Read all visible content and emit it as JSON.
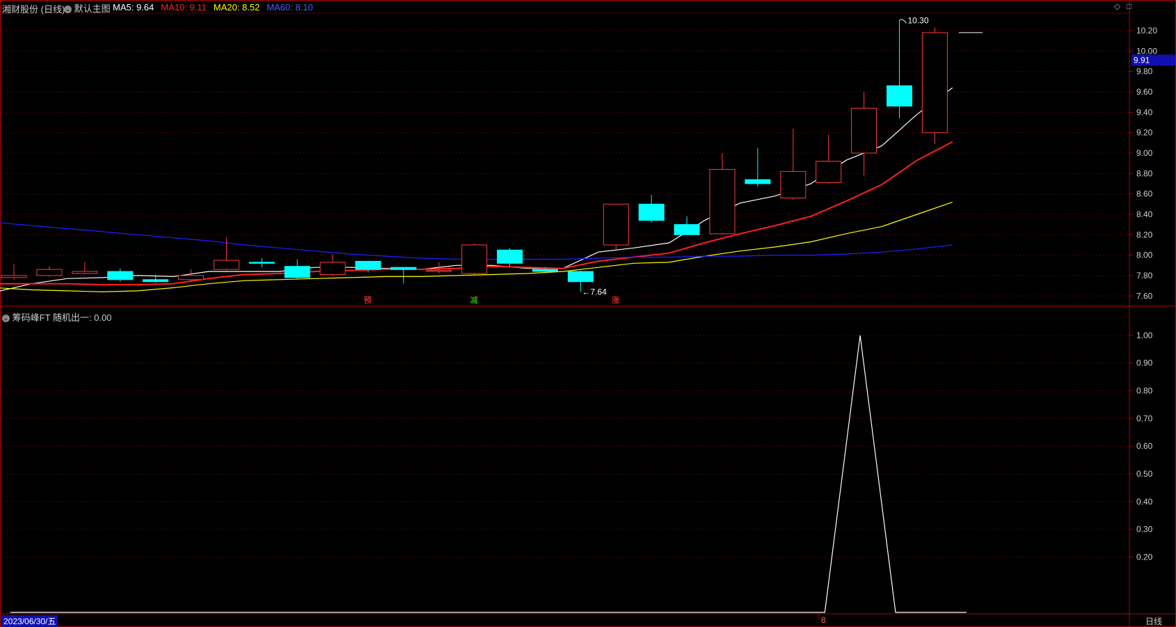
{
  "header": {
    "stock": "湘财股份 (日线)",
    "layout": "默认主图",
    "ma": [
      {
        "label": "MA5: 9.64",
        "color": "#ffffff"
      },
      {
        "label": "MA10: 9.11",
        "color": "#ff2020"
      },
      {
        "label": "MA20: 8.52",
        "color": "#ffff00"
      },
      {
        "label": "MA60: 8.10",
        "color": "#2020ff"
      }
    ]
  },
  "indicator": {
    "title": "筹码峰FT  随机出一: 0.00"
  },
  "footer": {
    "date": "2023/06/30/五",
    "marker": "8",
    "period": "日线"
  },
  "price_tag": "9.91",
  "controls": {
    "diamond": "◇",
    "square": "□"
  },
  "colors": {
    "up": "#ff3b3b",
    "down": "#00ffff",
    "axis": "#b40000",
    "grid": "#5a0000"
  },
  "chart_data": [
    {
      "type": "candlestick",
      "ylim": [
        7.52,
        10.35
      ],
      "yticks": [
        "7.60",
        "7.80",
        "8.00",
        "8.20",
        "8.40",
        "8.60",
        "8.80",
        "9.00",
        "9.20",
        "9.40",
        "9.60",
        "9.80",
        "10.00",
        "10.20"
      ],
      "candles": [
        {
          "o": 7.78,
          "h": 7.91,
          "l": 7.76,
          "c": 7.8
        },
        {
          "o": 7.8,
          "h": 7.89,
          "l": 7.79,
          "c": 7.86
        },
        {
          "o": 7.82,
          "h": 7.93,
          "l": 7.81,
          "c": 7.84
        },
        {
          "o": 7.84,
          "h": 7.87,
          "l": 7.74,
          "c": 7.76
        },
        {
          "o": 7.76,
          "h": 7.81,
          "l": 7.73,
          "c": 7.74
        },
        {
          "o": 7.76,
          "h": 7.86,
          "l": 7.75,
          "c": 7.8
        },
        {
          "o": 7.86,
          "h": 8.17,
          "l": 7.85,
          "c": 7.95
        },
        {
          "o": 7.93,
          "h": 7.97,
          "l": 7.88,
          "c": 7.92
        },
        {
          "o": 7.89,
          "h": 7.96,
          "l": 7.77,
          "c": 7.78
        },
        {
          "o": 7.81,
          "h": 8.01,
          "l": 7.79,
          "c": 7.93
        },
        {
          "o": 7.94,
          "h": 7.94,
          "l": 7.83,
          "c": 7.86
        },
        {
          "o": 7.88,
          "h": 7.88,
          "l": 7.72,
          "c": 7.86
        },
        {
          "o": 7.84,
          "h": 7.93,
          "l": 7.82,
          "c": 7.85
        },
        {
          "o": 7.82,
          "h": 8.11,
          "l": 7.81,
          "c": 8.1
        },
        {
          "o": 8.05,
          "h": 8.07,
          "l": 7.89,
          "c": 7.92
        },
        {
          "o": 7.86,
          "h": 7.88,
          "l": 7.82,
          "c": 7.84
        },
        {
          "o": 7.84,
          "h": 7.85,
          "l": 7.64,
          "c": 7.74
        },
        {
          "o": 8.1,
          "h": 8.5,
          "l": 8.05,
          "c": 8.5
        },
        {
          "o": 8.5,
          "h": 8.59,
          "l": 8.32,
          "c": 8.34
        },
        {
          "o": 8.3,
          "h": 8.38,
          "l": 8.2,
          "c": 8.2
        },
        {
          "o": 8.21,
          "h": 9.0,
          "l": 8.2,
          "c": 8.84
        },
        {
          "o": 8.74,
          "h": 9.05,
          "l": 8.67,
          "c": 8.7
        },
        {
          "o": 8.56,
          "h": 9.24,
          "l": 8.54,
          "c": 8.82
        },
        {
          "o": 8.71,
          "h": 9.18,
          "l": 8.7,
          "c": 8.92
        },
        {
          "o": 9.0,
          "h": 9.6,
          "l": 8.78,
          "c": 9.44
        },
        {
          "o": 9.66,
          "h": 10.3,
          "l": 9.34,
          "c": 9.46
        },
        {
          "o": 9.2,
          "h": 10.23,
          "l": 9.09,
          "c": 10.18
        }
      ],
      "series": [
        {
          "name": "MA5",
          "color": "#ffffff",
          "values": [
            7.64,
            7.72,
            7.77,
            7.78,
            7.8,
            7.79,
            7.84,
            7.84,
            7.84,
            7.88,
            7.88,
            7.87,
            7.86,
            7.9,
            7.9,
            7.87,
            7.87,
            8.03,
            8.07,
            8.12,
            8.34,
            8.51,
            8.58,
            8.7,
            8.93,
            9.07,
            9.38,
            9.64
          ]
        },
        {
          "name": "MA10",
          "color": "#ff2020",
          "values": [
            7.72,
            7.72,
            7.72,
            7.71,
            7.71,
            7.72,
            7.77,
            7.81,
            7.82,
            7.84,
            7.85,
            7.86,
            7.86,
            7.87,
            7.89,
            7.88,
            7.87,
            7.94,
            7.98,
            8.02,
            8.12,
            8.21,
            8.29,
            8.38,
            8.53,
            8.69,
            8.93,
            9.11
          ]
        },
        {
          "name": "MA20",
          "color": "#ffff00",
          "values": [
            7.68,
            7.66,
            7.65,
            7.64,
            7.65,
            7.68,
            7.72,
            7.75,
            7.76,
            7.77,
            7.78,
            7.79,
            7.79,
            7.8,
            7.81,
            7.82,
            7.84,
            7.88,
            7.92,
            7.93,
            7.99,
            8.04,
            8.08,
            8.13,
            8.21,
            8.28,
            8.4,
            8.52
          ]
        },
        {
          "name": "MA60",
          "color": "#2020ff",
          "values": [
            8.32,
            8.29,
            8.26,
            8.23,
            8.2,
            8.17,
            8.14,
            8.1,
            8.07,
            8.04,
            8.01,
            7.99,
            7.97,
            7.96,
            7.96,
            7.96,
            7.96,
            7.97,
            7.98,
            7.98,
            7.99,
            7.99,
            8.0,
            8.0,
            8.01,
            8.03,
            8.06,
            8.1
          ]
        }
      ],
      "annotations": [
        {
          "text": "10.30",
          "candle": 25,
          "value": 10.3
        },
        {
          "text": "←7.64",
          "candle": 16,
          "value": 7.64
        }
      ],
      "signals": [
        {
          "text": "预",
          "candle": 10,
          "color": "#ff4040"
        },
        {
          "text": "减",
          "candle": 13,
          "color": "#00ff00"
        },
        {
          "text": "涨",
          "candle": 17,
          "color": "#ff4040"
        }
      ]
    },
    {
      "type": "line",
      "ylim": [
        0,
        1.05
      ],
      "yticks": [
        "0.20",
        "0.30",
        "0.40",
        "0.50",
        "0.60",
        "0.70",
        "0.80",
        "0.90",
        "1.00"
      ],
      "points": [
        {
          "x": 0,
          "y": 0
        },
        {
          "x": 23,
          "y": 0
        },
        {
          "x": 24,
          "y": 1
        },
        {
          "x": 25,
          "y": 0
        },
        {
          "x": 27,
          "y": 0
        }
      ]
    }
  ]
}
